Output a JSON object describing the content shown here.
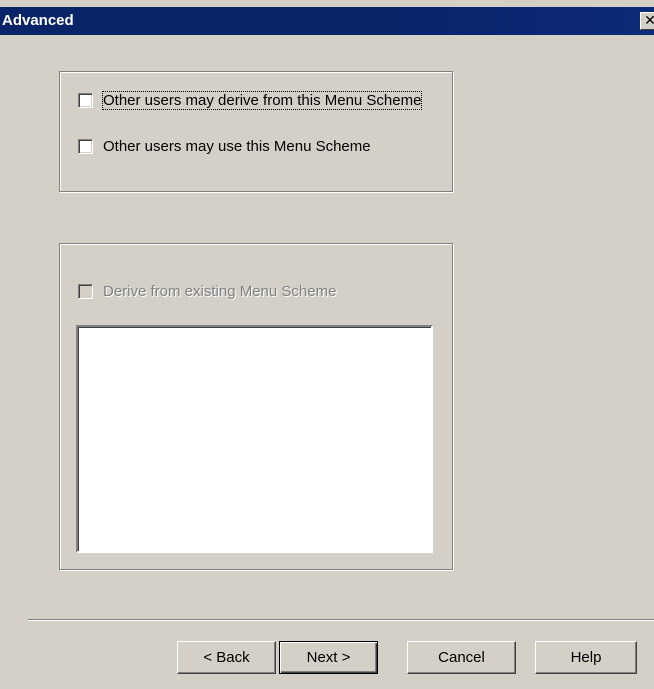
{
  "window": {
    "title": "Advanced",
    "close_glyph": "✕"
  },
  "permissions_group": {
    "derive_checkbox": {
      "label": "Other users may derive from this Menu Scheme",
      "checked": false
    },
    "use_checkbox": {
      "label": "Other users may use this Menu Scheme",
      "checked": false
    }
  },
  "derive_group": {
    "derive_existing_checkbox": {
      "label": "Derive from existing Menu Scheme",
      "checked": false,
      "enabled": false
    },
    "scheme_list": {
      "items": []
    }
  },
  "buttons": {
    "back": "< Back",
    "next": "Next >",
    "cancel": "Cancel",
    "help": "Help"
  },
  "colors": {
    "titlebar": "#0a246a",
    "face": "#d4d0c8"
  }
}
